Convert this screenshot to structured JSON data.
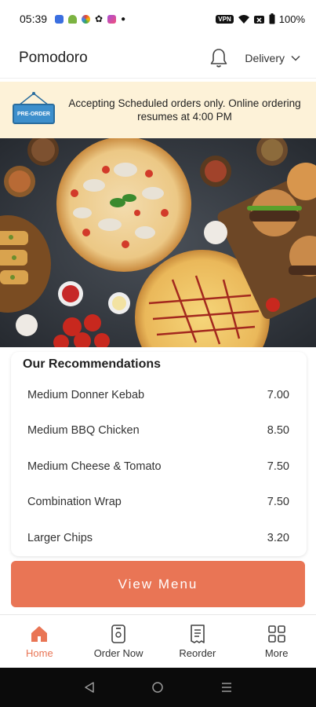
{
  "status_bar": {
    "time": "05:39",
    "vpn_label": "VPN",
    "battery_text": "100%"
  },
  "header": {
    "title": "Pomodoro",
    "delivery_label": "Delivery"
  },
  "banner": {
    "tag_text": "PRE-ORDER",
    "message": "Accepting Scheduled orders only. Online ordering resumes at 4:00 PM"
  },
  "recommendations": {
    "title": "Our Recommendations",
    "items": [
      {
        "name": "Medium Donner Kebab",
        "price": "7.00"
      },
      {
        "name": "Medium BBQ Chicken",
        "price": "8.50"
      },
      {
        "name": "Medium Cheese & Tomato",
        "price": "7.50"
      },
      {
        "name": "Combination Wrap",
        "price": "7.50"
      },
      {
        "name": "Larger Chips",
        "price": "3.20"
      }
    ]
  },
  "view_menu_label": "View Menu",
  "bottom_nav": {
    "items": [
      {
        "label": "Home",
        "icon": "home-icon",
        "active": true
      },
      {
        "label": "Order Now",
        "icon": "order-icon"
      },
      {
        "label": "Reorder",
        "icon": "receipt-icon"
      },
      {
        "label": "More",
        "icon": "grid-icon"
      }
    ]
  },
  "colors": {
    "accent": "#e97555",
    "banner_bg": "#fdf2d8",
    "preorder_blue": "#3d8fcc"
  }
}
